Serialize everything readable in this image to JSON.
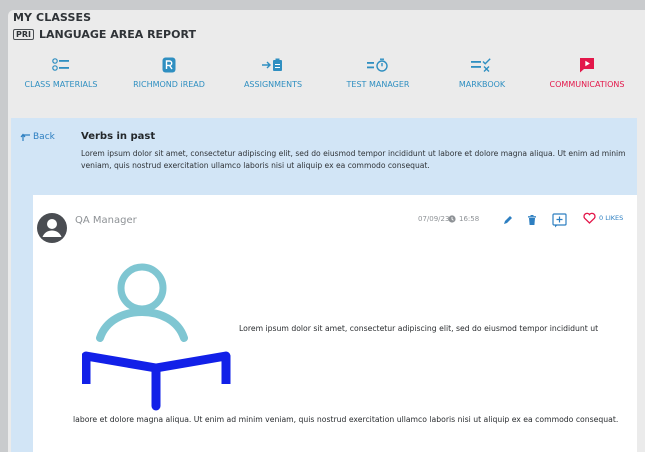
{
  "header": {
    "title": "MY CLASSES",
    "badge": "PRI",
    "subtitle": "LANGUAGE AREA REPORT"
  },
  "nav": [
    {
      "label": "CLASS MATERIALS",
      "icon": "list-icon"
    },
    {
      "label": "RICHMOND iREAD",
      "icon": "richmond-r-icon"
    },
    {
      "label": "ASSIGNMENTS",
      "icon": "assignment-arrow-icon"
    },
    {
      "label": "TEST MANAGER",
      "icon": "timer-icon"
    },
    {
      "label": "MARKBOOK",
      "icon": "markbook-check-icon"
    },
    {
      "label": "COMMUNICATIONS",
      "icon": "play-message-icon",
      "active": true
    }
  ],
  "back_label": "Back",
  "lesson": {
    "title": "Verbs in past",
    "description": "Lorem ipsum dolor sit amet, consectetur adipiscing elit, sed do eiusmod tempor incididunt ut labore et dolore magna aliqua. Ut enim ad minim veniam, quis nostrud exercitation ullamco laboris nisi ut aliquip ex ea commodo consequat."
  },
  "post": {
    "author": "QA Manager",
    "date": "07/09/23",
    "time": "16:58",
    "likes": "0 LIKES",
    "text_line1": "Lorem ipsum dolor sit amet, consectetur adipiscing elit, sed do eiusmod tempor incididunt ut",
    "text_rest": "labore et dolore magna aliqua. Ut enim ad minim veniam, quis nostrud exercitation ullamco laboris nisi ut aliquip ex ea commodo consequat."
  },
  "colors": {
    "accent_blue": "#2d7fc1",
    "active_red": "#e3174a",
    "content_bg": "#d2e5f6",
    "illustration_teal": "#7fc6d2",
    "illustration_blue": "#1220e8"
  }
}
